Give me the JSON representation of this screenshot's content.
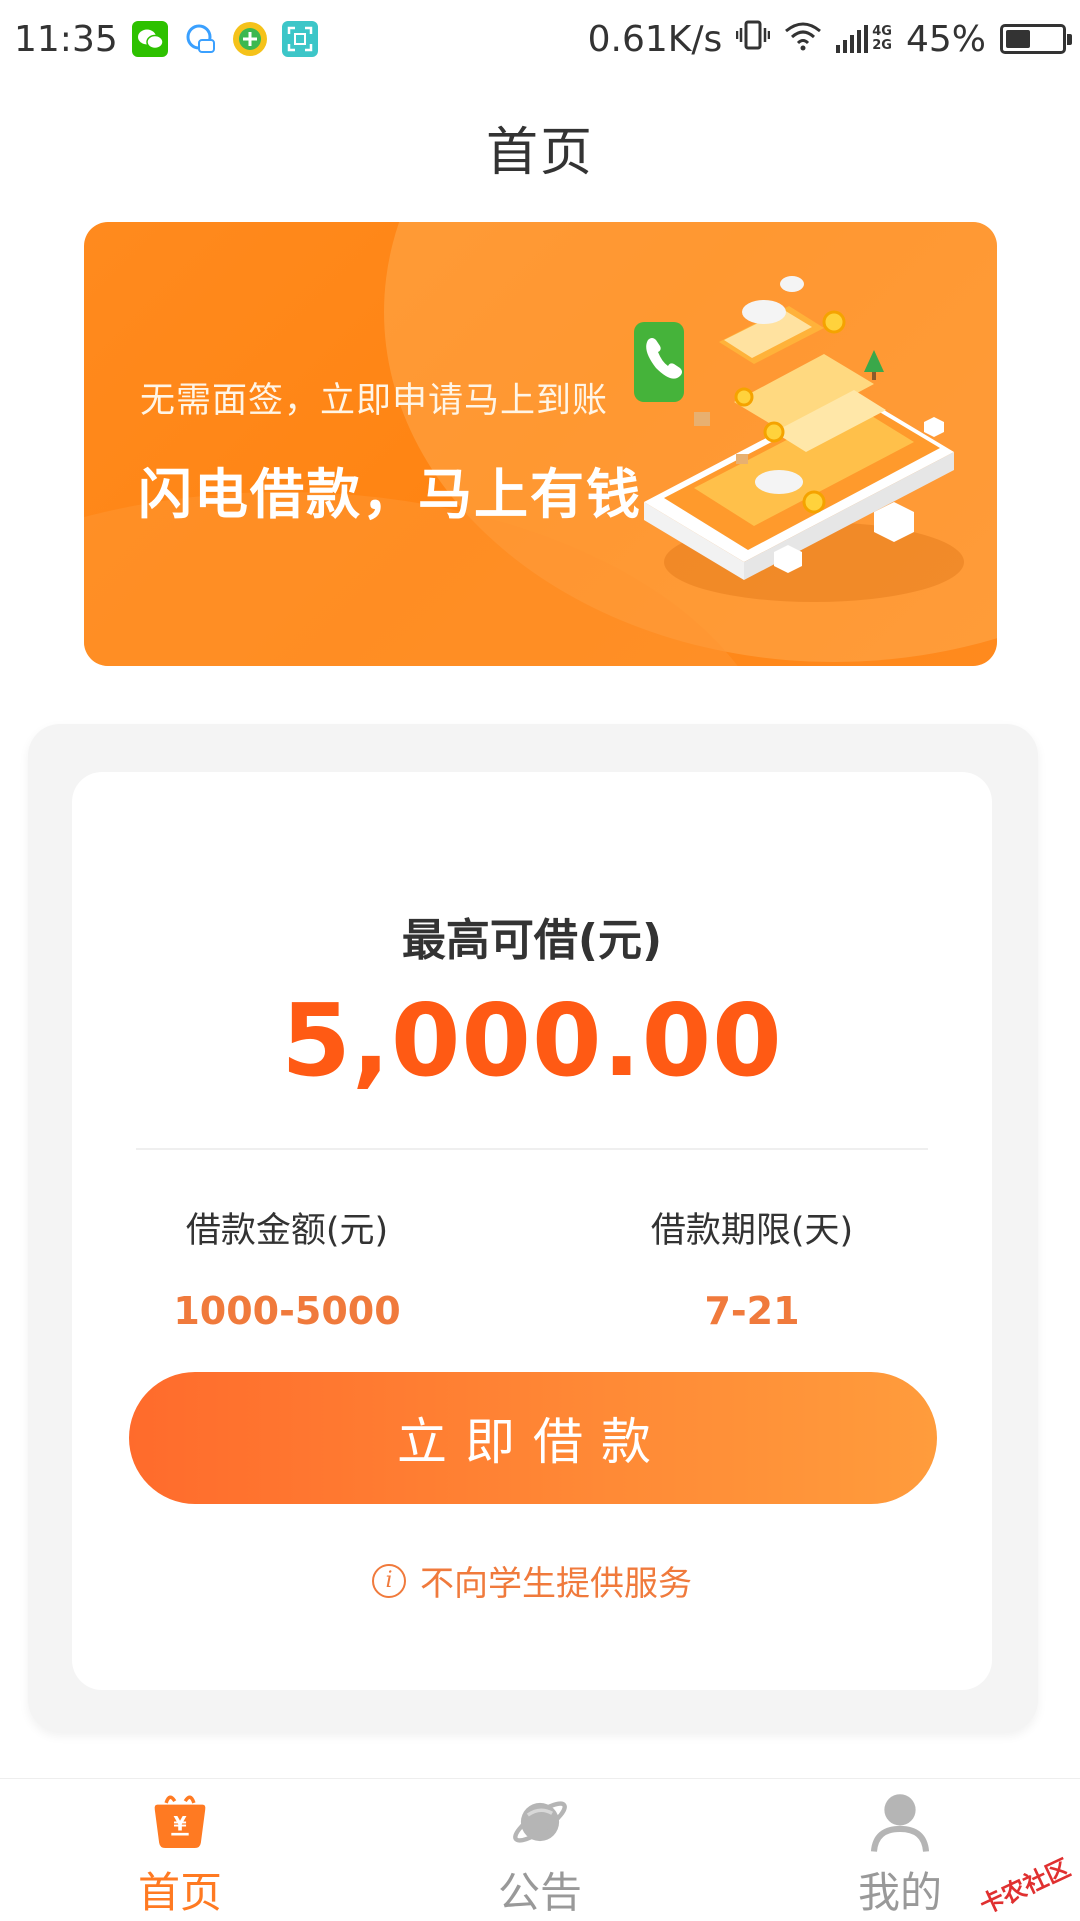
{
  "status_bar": {
    "time": "11:35",
    "net_speed": "0.61K/s",
    "signal_top": "4G",
    "signal_bottom": "2G",
    "battery": "45%",
    "battery_level": 0.45
  },
  "header": {
    "title": "首页"
  },
  "banner": {
    "subtitle": "无需面签，立即申请马上到账",
    "title": "闪电借款，马上有钱"
  },
  "loan": {
    "max_label": "最高可借(元)",
    "max_amount": "5,000.00",
    "amount_label": "借款金额(元)",
    "amount_range": "1000-5000",
    "term_label": "借款期限(天)",
    "term_range": "7-21",
    "apply_button": "立即借款",
    "notice": "不向学生提供服务"
  },
  "tabbar": {
    "tabs": [
      {
        "label": "首页",
        "icon": "shopping-bag-yen-icon",
        "active": true
      },
      {
        "label": "公告",
        "icon": "planet-icon",
        "active": false
      },
      {
        "label": "我的",
        "icon": "user-icon",
        "active": false
      }
    ]
  },
  "watermark": "卡农社区",
  "colors": {
    "accent": "#ff7a22",
    "amount": "#ff5a14",
    "banner": "#ff8412",
    "inactive": "#999999"
  }
}
